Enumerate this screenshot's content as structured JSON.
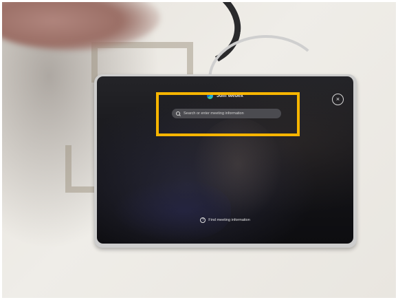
{
  "device_screen": {
    "title": "Join Webex",
    "title_icon": "webex-logo-icon",
    "close_icon": "close-icon",
    "close_symbol": "×",
    "search": {
      "icon": "search-icon",
      "placeholder": "Search or enter meeting information",
      "value": ""
    },
    "footer": {
      "icon": "info-icon",
      "info_symbol": "?",
      "label": "Find meeting information"
    }
  },
  "highlight_color": "#f7b500"
}
